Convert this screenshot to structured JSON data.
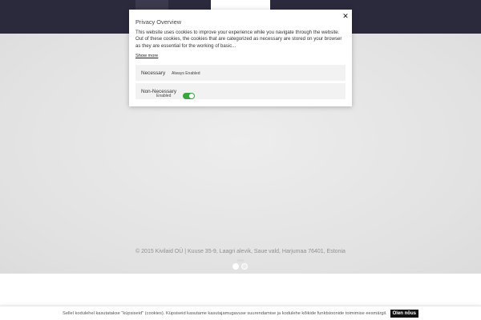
{
  "modal": {
    "title": "Privacy Overview",
    "close_label": "✕",
    "body": "This website uses cookies to improve your experience while you navigate through the website. Out of these cookies, the cookies that are categorized as necessary are stored on your browser as they are essential for the working of basic...",
    "show_more": "Show more",
    "preferences": [
      {
        "name": "Necessary",
        "status": "Always Enabled"
      },
      {
        "name": "Non-Necessary",
        "status": "Enabled",
        "enabled": true
      }
    ]
  },
  "footer": {
    "copyright": "© 2015 Kivilaid OÜ | Kuuse 35-9, Laagri alevik, Saue vald, Harjumaa 76401, Estonia"
  },
  "slider": {
    "dot_count": 2,
    "active_index": 0
  },
  "cookie_bar": {
    "text": "Sellel kodulehel kasutatakse \"küpsiseid\" (cookies). Küpsiseid kasutame kasutajamugavuse suurendamise ja kodulehe kõikide funktsioonide toimimise eesmärgil.",
    "accept_label": "Olen nõus"
  },
  "colors": {
    "header_bg": "#2b2a3c",
    "toggle_on": "#3aa43e",
    "accept_button_bg": "#111111"
  }
}
